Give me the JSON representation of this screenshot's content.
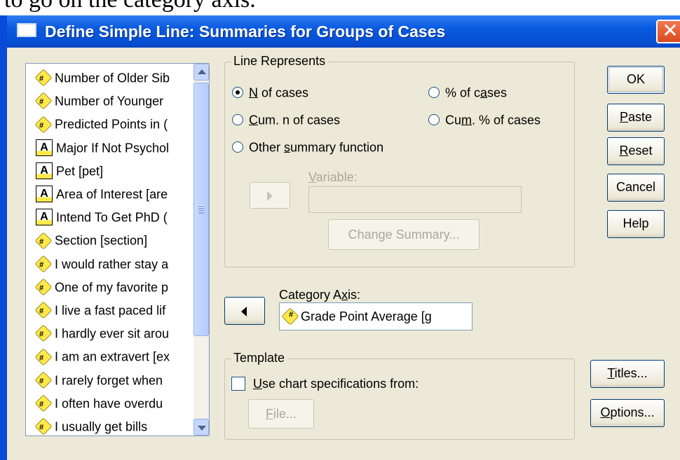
{
  "above_text": "to go on the category axis.",
  "window": {
    "title": "Define Simple Line: Summaries for Groups of Cases",
    "close_label": "✕"
  },
  "variables": [
    {
      "label": "Number of Older Sib",
      "type": "numeric"
    },
    {
      "label": "Number of Younger",
      "type": "numeric"
    },
    {
      "label": "Predicted Points in (",
      "type": "numeric"
    },
    {
      "label": "Major If Not Psychol",
      "type": "string"
    },
    {
      "label": "Pet [pet]",
      "type": "string"
    },
    {
      "label": "Area of Interest [are",
      "type": "string"
    },
    {
      "label": "Intend To Get PhD (",
      "type": "string"
    },
    {
      "label": "Section [section]",
      "type": "numeric"
    },
    {
      "label": "I would rather stay a",
      "type": "numeric"
    },
    {
      "label": "One of my favorite p",
      "type": "numeric"
    },
    {
      "label": "I live a fast paced lif",
      "type": "numeric"
    },
    {
      "label": "I hardly ever sit arou",
      "type": "numeric"
    },
    {
      "label": "I am an extravert [ex",
      "type": "numeric"
    },
    {
      "label": "I rarely forget when",
      "type": "numeric"
    },
    {
      "label": "I often have overdu",
      "type": "numeric"
    },
    {
      "label": "I usually get bills",
      "type": "numeric"
    }
  ],
  "line_represents": {
    "label": "Line Represents",
    "n_cases": {
      "pre": "",
      "u": "N",
      "post": " of cases",
      "selected": true
    },
    "pct_cases": {
      "pre": "% of c",
      "u": "a",
      "post": "ses",
      "selected": false
    },
    "cum_n": {
      "pre": "",
      "u": "C",
      "post": "um. n of cases",
      "selected": false
    },
    "cum_pct": {
      "pre": "Cu",
      "u": "m",
      "post": ". % of cases",
      "selected": false
    },
    "other": {
      "pre": "Other ",
      "u": "s",
      "post": "ummary function",
      "selected": false
    },
    "variable_label": {
      "pre": "",
      "u": "V",
      "post": "ariable:"
    },
    "change_summary": "Change Summary..."
  },
  "category_axis": {
    "label_pre": "Category A",
    "label_u": "x",
    "label_post": "is:",
    "value": "Grade Point Average [g"
  },
  "template": {
    "label": "Template",
    "use_spec_u": "U",
    "use_spec_post": "se chart specifications from:",
    "checked": false,
    "file_u": "F",
    "file_post": "ile..."
  },
  "buttons": {
    "ok": "OK",
    "paste_u": "P",
    "paste_post": "aste",
    "reset_u": "R",
    "reset_post": "eset",
    "cancel": "Cancel",
    "help": "Help",
    "titles_u": "T",
    "titles_post": "itles...",
    "options_u": "O",
    "options_post": "ptions..."
  }
}
